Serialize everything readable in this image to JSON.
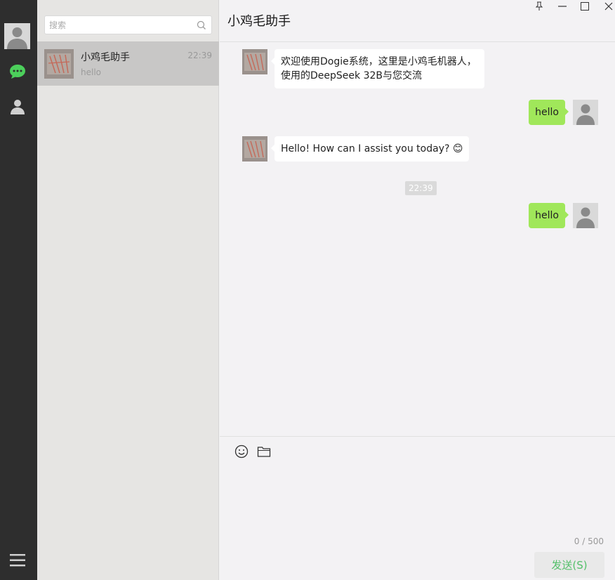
{
  "search": {
    "placeholder": "搜索"
  },
  "conversations": [
    {
      "name": "小鸡毛助手",
      "time": "22:39",
      "preview": "hello"
    }
  ],
  "chat": {
    "title": "小鸡毛助手",
    "messages": [
      {
        "from": "bot",
        "text": "欢迎使用Dogie系统，这里是小鸡毛机器人，使用的DeepSeek 32B与您交流"
      },
      {
        "from": "user",
        "text": "hello"
      },
      {
        "from": "bot",
        "text": "Hello! How can I assist you today? 😊"
      },
      {
        "from": "user",
        "text": "hello"
      }
    ],
    "timestamp": "22:39"
  },
  "composer": {
    "counter": "0 / 500",
    "send_label": "发送(S)"
  },
  "colors": {
    "accent": "#a0e75a",
    "nav_bg": "#2e2e2e",
    "send_text": "#54c06a"
  }
}
